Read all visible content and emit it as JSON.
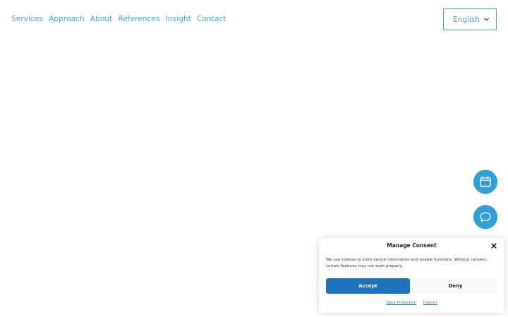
{
  "nav": {
    "items": [
      "Services",
      "Approach",
      "About",
      "References",
      "Insight",
      "Contact"
    ]
  },
  "language": {
    "selected": "English",
    "icon": "chevron-down-icon"
  },
  "fabs": {
    "calendar_icon": "calendar-icon",
    "chat_icon": "chat-bubble-icon"
  },
  "consent": {
    "title": "Manage Consent",
    "message": "We use cookies to store device information and enable functions. Without consent, certain features may not work properly.",
    "accept_label": "Accept",
    "deny_label": "Deny",
    "links": [
      "Data Protection",
      "Imprint"
    ]
  },
  "colors": {
    "accent": "#3fa9d6",
    "fab": "#2f9fd6",
    "primary_button": "#1e73be"
  }
}
